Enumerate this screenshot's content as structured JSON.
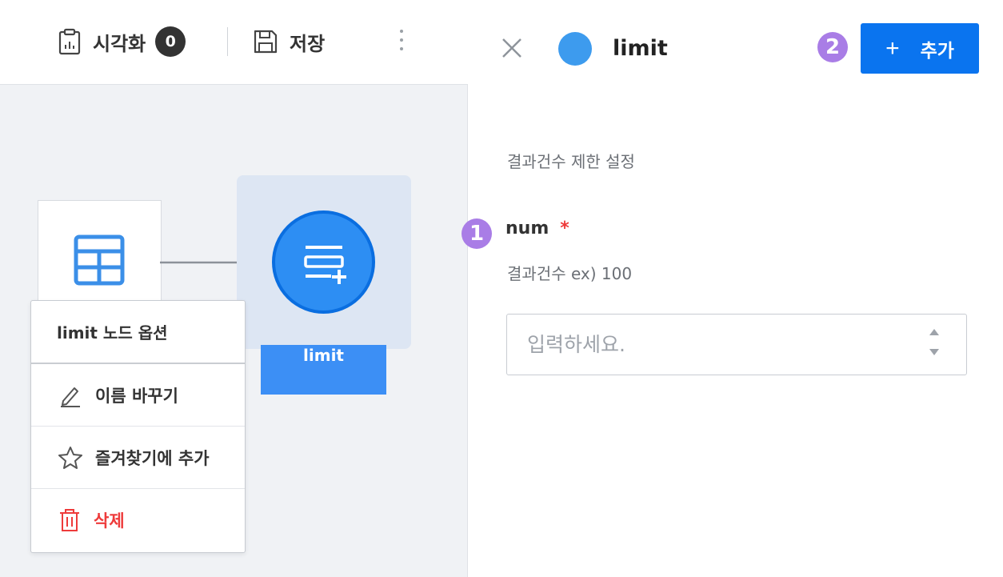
{
  "toolbar": {
    "visualize_label": "시각화",
    "visualize_count": "0",
    "save_label": "저장"
  },
  "canvas": {
    "limit_node_label": "limit"
  },
  "context_menu": {
    "title": "limit 노드 옵션",
    "items": [
      {
        "label": "이름 바꾸기",
        "icon": "pencil-icon"
      },
      {
        "label": "즐겨찾기에 추가",
        "icon": "star-icon"
      },
      {
        "label": "삭제",
        "icon": "trash-icon",
        "color": "#ee3b3b"
      }
    ]
  },
  "panel": {
    "title": "limit",
    "node_color": "#3d9bee",
    "add_button_label": "추가",
    "add_button_color": "#0a74ef",
    "section_description": "결과건수 제한 설정",
    "field": {
      "label": "num",
      "required_mark": "*",
      "hint": "결과건수 ex) 100",
      "placeholder": "입력하세요.",
      "value": ""
    }
  },
  "markers": {
    "field_marker": "1",
    "button_marker": "2",
    "color": "#a97de6"
  }
}
